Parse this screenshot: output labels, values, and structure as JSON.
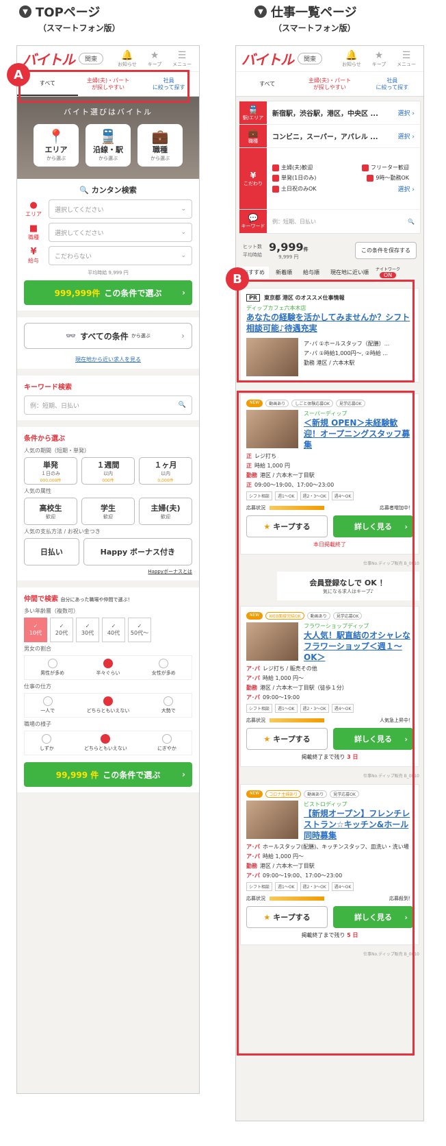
{
  "left": {
    "heading": "TOPページ",
    "sub": "（スマートフォン版）",
    "logo": "バイトル",
    "area": "関東",
    "icons": [
      "お知らせ",
      "キープ",
      "メニュー"
    ],
    "tabs": [
      "すべて",
      "主婦(夫)・パート\nが探しやすい",
      "社員\nに絞って探す"
    ],
    "catch": "バイト選びはバイトル",
    "hero_btns": [
      {
        "label": "エリア",
        "sub": "から選ぶ"
      },
      {
        "label": "沿線・駅",
        "sub": "から選ぶ"
      },
      {
        "label": "職種",
        "sub": "から選ぶ"
      }
    ],
    "quick": "カンタン検索",
    "rows": [
      {
        "lab": "エリア",
        "val": "選択してください"
      },
      {
        "lab": "職種",
        "val": "選択してください"
      },
      {
        "lab": "給与",
        "val": "こだわらない"
      }
    ],
    "avg": "平均時給 9,999 円",
    "btn1_count": "999,999件",
    "btn1": "この条件で選ぶ",
    "all_cond": "すべての条件",
    "all_cond_sub": "から選ぶ",
    "nearby": "現在地から近い求人を見る",
    "kw_title": "キーワード検索",
    "kw_ph": "例：短期、日払い",
    "cond_title": "条件から選ぶ",
    "period_title": "人気の期間（短期・単発）",
    "period": [
      {
        "l": "単発",
        "s": "１日のみ",
        "p": "000,000件"
      },
      {
        "l": "１週間",
        "s": "以内",
        "p": "000件"
      },
      {
        "l": "１ヶ月",
        "s": "以内",
        "p": "0,000件"
      }
    ],
    "attr_title": "人気の属性",
    "attr": [
      {
        "l": "高校生",
        "s": "歓迎"
      },
      {
        "l": "学生",
        "s": "歓迎"
      },
      {
        "l": "主婦(夫)",
        "s": "歓迎"
      }
    ],
    "pay_title": "人気の支払方法 / お祝い金つき",
    "pay": [
      "日払い",
      "Happy ボーナス付き"
    ],
    "happy": "Happyボーナスとは",
    "scene_title": "仲間で検索",
    "scene_sub": "自分にあった職場や仲間で選ぶ！",
    "age_title": "多い年齢層（複数可）",
    "ages": [
      "10代",
      "20代",
      "30代",
      "40代",
      "50代〜"
    ],
    "gender_title": "男女の割合",
    "gender": [
      "男性が多め",
      "半々ぐらい",
      "女性が多め"
    ],
    "work_title": "仕事の仕方",
    "work": [
      "一人で",
      "どちらともいえない",
      "大勢で"
    ],
    "env_title": "職場の様子",
    "env": [
      "しずか",
      "どちらともいえない",
      "にぎやか"
    ],
    "btn2_count": "99,999 件",
    "btn2": "この条件で選ぶ"
  },
  "right": {
    "heading": "仕事一覧ページ",
    "sub": "（スマートフォン版）",
    "rows": [
      {
        "l": "駅/エリア",
        "v": "新宿駅，渋谷駅，港区，中央区 ..."
      },
      {
        "l": "職種",
        "v": "コンビニ，スーパー，アパレル ..."
      }
    ],
    "choose": "選択",
    "pref_label": "こだわり",
    "prefs": [
      "主婦(夫)歓迎",
      "フリーター歓迎",
      "単発(1日のみ)",
      "9時〜勤務OK",
      "土日祝のみOK"
    ],
    "kw_label": "キーワード",
    "kw_ph": "例：短期、日払い",
    "hits_label": "ヒット数",
    "hits": "9,999",
    "hits_unit": "件",
    "avg_label": "平均時給",
    "avg": "9,999 円",
    "save": "この条件を保存する",
    "sorts": [
      "おすすめ",
      "新着順",
      "給与順",
      "現在地に近い順"
    ],
    "nightwork": "ナイトワーク",
    "on": "ON",
    "pr": "PR",
    "pr_title": "東京都 港区 のオススメ仕事情報",
    "pr_company": "ディップカフェ六本木店",
    "pr_job": "あなたの経験を活かしてみませんか？シフト相談可能♪待遇充実",
    "pr_lines": [
      "ア･パ ①ホールスタッフ（配膳）...",
      "ア･パ ①時給1,000円〜, ②時給 ...",
      "勤務 港区 / 六本木駅"
    ],
    "cards": [
      {
        "tags": [
          "NEW",
          "動画あり",
          "しごと体験応募OK",
          "見学応募OK"
        ],
        "company": "スーパーディップ",
        "title": "＜新規 OPEN＞未経験歓迎！オープニングスタッフ募集",
        "lines": [
          [
            "正",
            "レジ打ち"
          ],
          [
            "正",
            "時給 1,000 円"
          ],
          [
            "勤務",
            "港区 / 六本木一丁目駅"
          ],
          [
            "正",
            "09:00〜19:00、17:00〜23:00"
          ]
        ],
        "status": "応募者増加中！",
        "end": "本日掲載終了",
        "code": "仕事No.ディップ販売 B_0010"
      },
      {
        "tags": [
          "NEW",
          "WEB面接完結OK",
          "動画あり",
          "見学応募OK"
        ],
        "company": "フラワーショップディップ",
        "title": "大人気！駅直結のオシャレなフラワーショップ＜週１〜OK＞",
        "lines": [
          [
            "ア･パ",
            "レジ打ち / 販売その他"
          ],
          [
            "ア･パ",
            "時給 1,000 円〜"
          ],
          [
            "勤務",
            "港区 / 六本木一丁目駅（徒歩１分）"
          ],
          [
            "ア･パ",
            "09:00〜19:00"
          ]
        ],
        "status": "人気急上昇中！",
        "end_pre": "掲載終了まで残り",
        "end_num": "3 日",
        "code": "仕事No.ディップ販売 B_0010"
      },
      {
        "tags": [
          "NEW",
          "コロナ主婦あり",
          "動画あり",
          "見学応募OK"
        ],
        "company": "ビストロディップ",
        "title": "【新規オープン】フレンチレストラン☆キッチン&ホール同時募集",
        "lines": [
          [
            "ア･パ",
            "ホールスタッフ(配膳)、キッチンスタッフ、皿洗い・洗い場"
          ],
          [
            "ア･パ",
            "時給 1,000 円〜"
          ],
          [
            "勤務",
            "港区 / 六本木一丁目駅"
          ],
          [
            "ア･パ",
            "09:00〜19:00、17:00〜23:00"
          ]
        ],
        "status": "応募殺到！",
        "end_pre": "掲載終了まで残り",
        "end_num": "5 日",
        "code": "仕事No.ディップ販売 B_0010"
      }
    ],
    "shifts": [
      "シフト相談",
      "週1〜OK",
      "週2・3〜OK",
      "週4〜OK"
    ],
    "keep": "キープする",
    "detail": "詳しく見る",
    "status_label": "応募状況",
    "member": "会員登録なしで OK ！",
    "member_sub": "気になる求人はキープ♪"
  },
  "badges": {
    "a": "A",
    "b": "B"
  },
  "colors": {
    "accent": "#e4313b",
    "green": "#3fb443",
    "link": "#2a6fc4"
  }
}
